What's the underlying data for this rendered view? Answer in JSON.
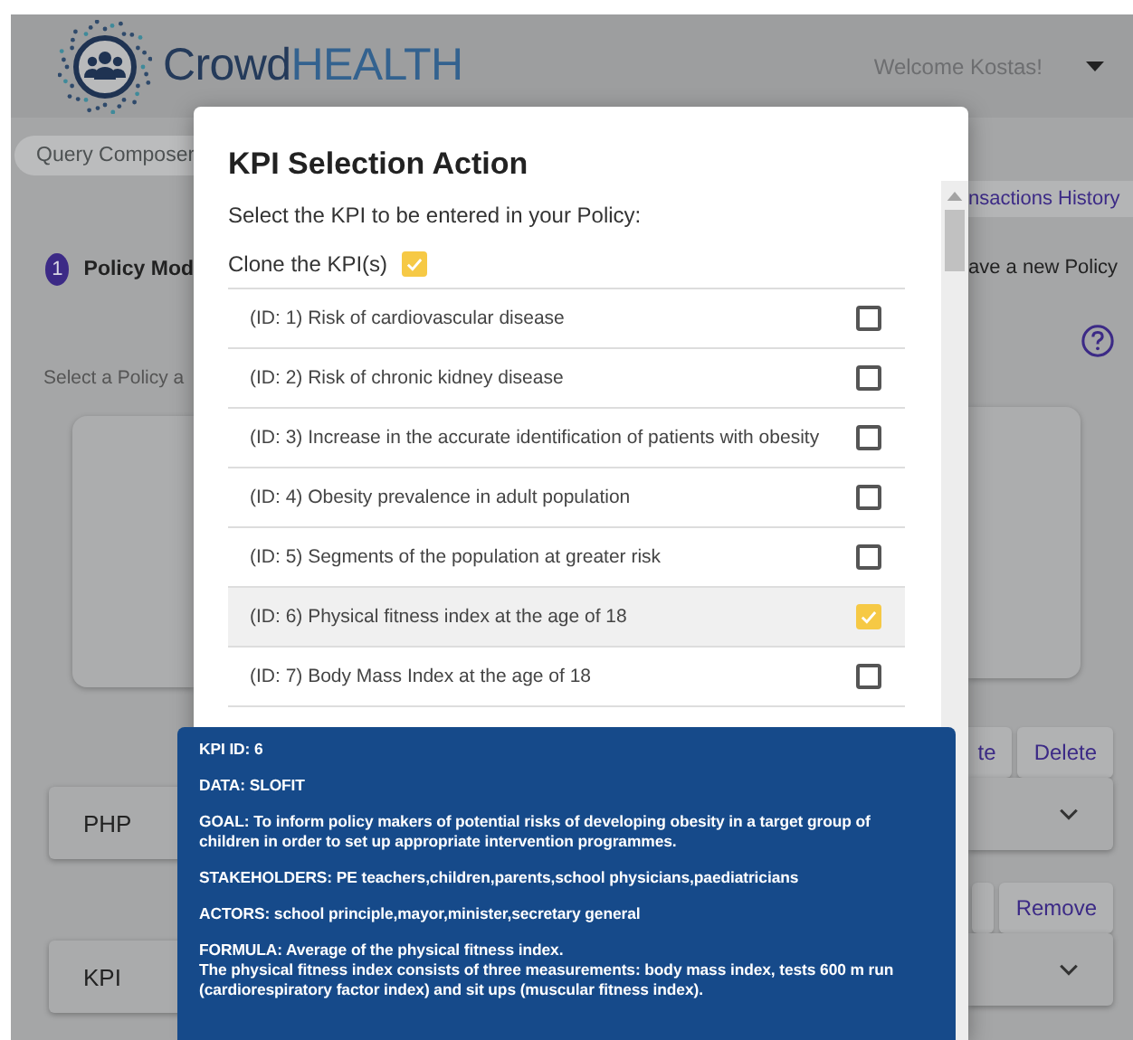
{
  "header": {
    "logo": [
      "Crowd",
      "HEALTH"
    ],
    "welcome": "Welcome Kostas!"
  },
  "left": {
    "tab": "Query Composer",
    "step_number": "1",
    "step_label": "Policy Mod",
    "hint": "Select a Policy a",
    "panels": [
      "PHP",
      "KPI"
    ]
  },
  "right": {
    "tab": "nsactions History",
    "action": "ave a new Policy",
    "buttons_top": [
      "te",
      "Delete"
    ],
    "buttons_bottom": [
      "Remove"
    ]
  },
  "modal": {
    "title": "KPI Selection Action",
    "prompt": "Select the KPI to be entered in your Policy:",
    "clone": {
      "label": "Clone the KPI(s)",
      "checked": true
    },
    "kpis": [
      {
        "label": "(ID: 1) Risk of cardiovascular disease",
        "checked": false,
        "selected": false
      },
      {
        "label": "(ID: 2) Risk of chronic kidney disease",
        "checked": false,
        "selected": false
      },
      {
        "label": "(ID: 3) Increase in the accurate identification of patients with obesity",
        "checked": false,
        "selected": false
      },
      {
        "label": "(ID: 4) Obesity prevalence in adult population",
        "checked": false,
        "selected": false
      },
      {
        "label": "(ID: 5) Segments of the population at greater risk",
        "checked": false,
        "selected": false
      },
      {
        "label": "(ID: 6) Physical fitness index at the age of 18",
        "checked": true,
        "selected": true
      },
      {
        "label": "(ID: 7) Body Mass Index at the age of 18",
        "checked": false,
        "selected": false
      }
    ]
  },
  "tooltip": {
    "paragraphs": [
      "KPI ID: 6",
      "DATA: SLOFIT",
      "GOAL: To inform policy makers of potential risks of developing obesity in a target group of\nchildren in order to set up appropriate intervention programmes.",
      "STAKEHOLDERS: PE teachers,children,parents,school physicians,paediatricians",
      "ACTORS: school principle,mayor,minister,secretary general",
      "FORMULA: Average of the physical fitness index.\nThe physical fitness index consists of three measurements: body mass index, tests 600 m run\n(cardiorespiratory factor index) and sit ups (muscular fitness index)."
    ]
  }
}
